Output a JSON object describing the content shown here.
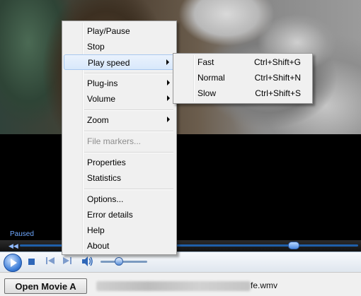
{
  "player": {
    "status": "Paused",
    "seek_fraction": 0.81,
    "volume_fraction": 0.4
  },
  "bottom": {
    "open_button": "Open Movie A",
    "file_suffix": "fe.wmv"
  },
  "context_menu": {
    "items": [
      {
        "label": "Play/Pause"
      },
      {
        "label": "Stop"
      },
      {
        "label": "Play speed",
        "submenu": true
      },
      {
        "label": "Plug-ins",
        "submenu": true
      },
      {
        "label": "Volume",
        "submenu": true
      },
      {
        "label": "Zoom",
        "submenu": true
      },
      {
        "label": "File markers..."
      },
      {
        "label": "Properties"
      },
      {
        "label": "Statistics"
      },
      {
        "label": "Options..."
      },
      {
        "label": "Error details"
      },
      {
        "label": "Help"
      },
      {
        "label": "About"
      }
    ]
  },
  "speed_submenu": {
    "items": [
      {
        "label": "Fast",
        "shortcut": "Ctrl+Shift+G"
      },
      {
        "label": "Normal",
        "shortcut": "Ctrl+Shift+N"
      },
      {
        "label": "Slow",
        "shortcut": "Ctrl+Shift+S"
      }
    ]
  },
  "icons": {
    "play": "play-icon",
    "stop": "stop-icon",
    "previous": "previous-icon",
    "next": "next-icon",
    "volume": "speaker-icon",
    "submenu": "chevron-right-icon"
  },
  "colors": {
    "accent": "#245aa8",
    "menu_background": "#f0f0f0",
    "highlight": "#d8e8fb"
  }
}
